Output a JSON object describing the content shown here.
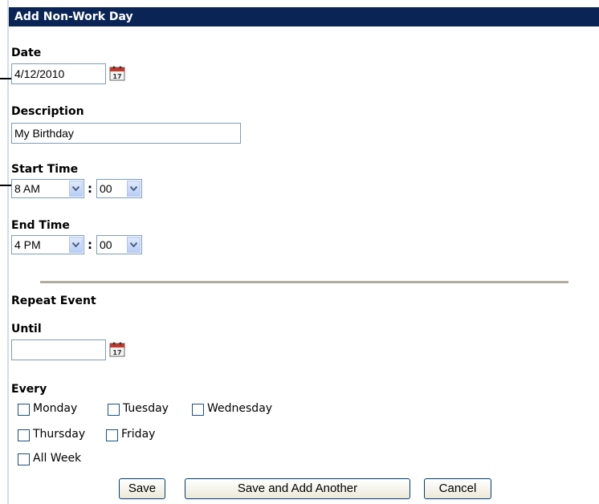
{
  "header": {
    "title": "Add Non-Work Day"
  },
  "date": {
    "label": "Date",
    "value": "4/12/2010"
  },
  "description": {
    "label": "Description",
    "value": "My Birthday"
  },
  "start_time": {
    "label": "Start Time",
    "hour": "8 AM",
    "minute": "00"
  },
  "end_time": {
    "label": "End Time",
    "hour": "4 PM",
    "minute": "00"
  },
  "colon": ":",
  "repeat": {
    "title": "Repeat Event",
    "until_label": "Until",
    "until_value": "",
    "every_label": "Every",
    "days": {
      "monday": "Monday",
      "tuesday": "Tuesday",
      "wednesday": "Wednesday",
      "thursday": "Thursday",
      "friday": "Friday",
      "all_week": "All Week"
    }
  },
  "buttons": {
    "save": "Save",
    "save_add": "Save and Add Another",
    "cancel": "Cancel"
  },
  "icons": {
    "calendar": "calendar-icon",
    "dropdown": "chevron-down-icon"
  },
  "colors": {
    "header_bg": "#0a2456",
    "divider": "#b0ad9e",
    "select_arrow": "#4d6185"
  }
}
